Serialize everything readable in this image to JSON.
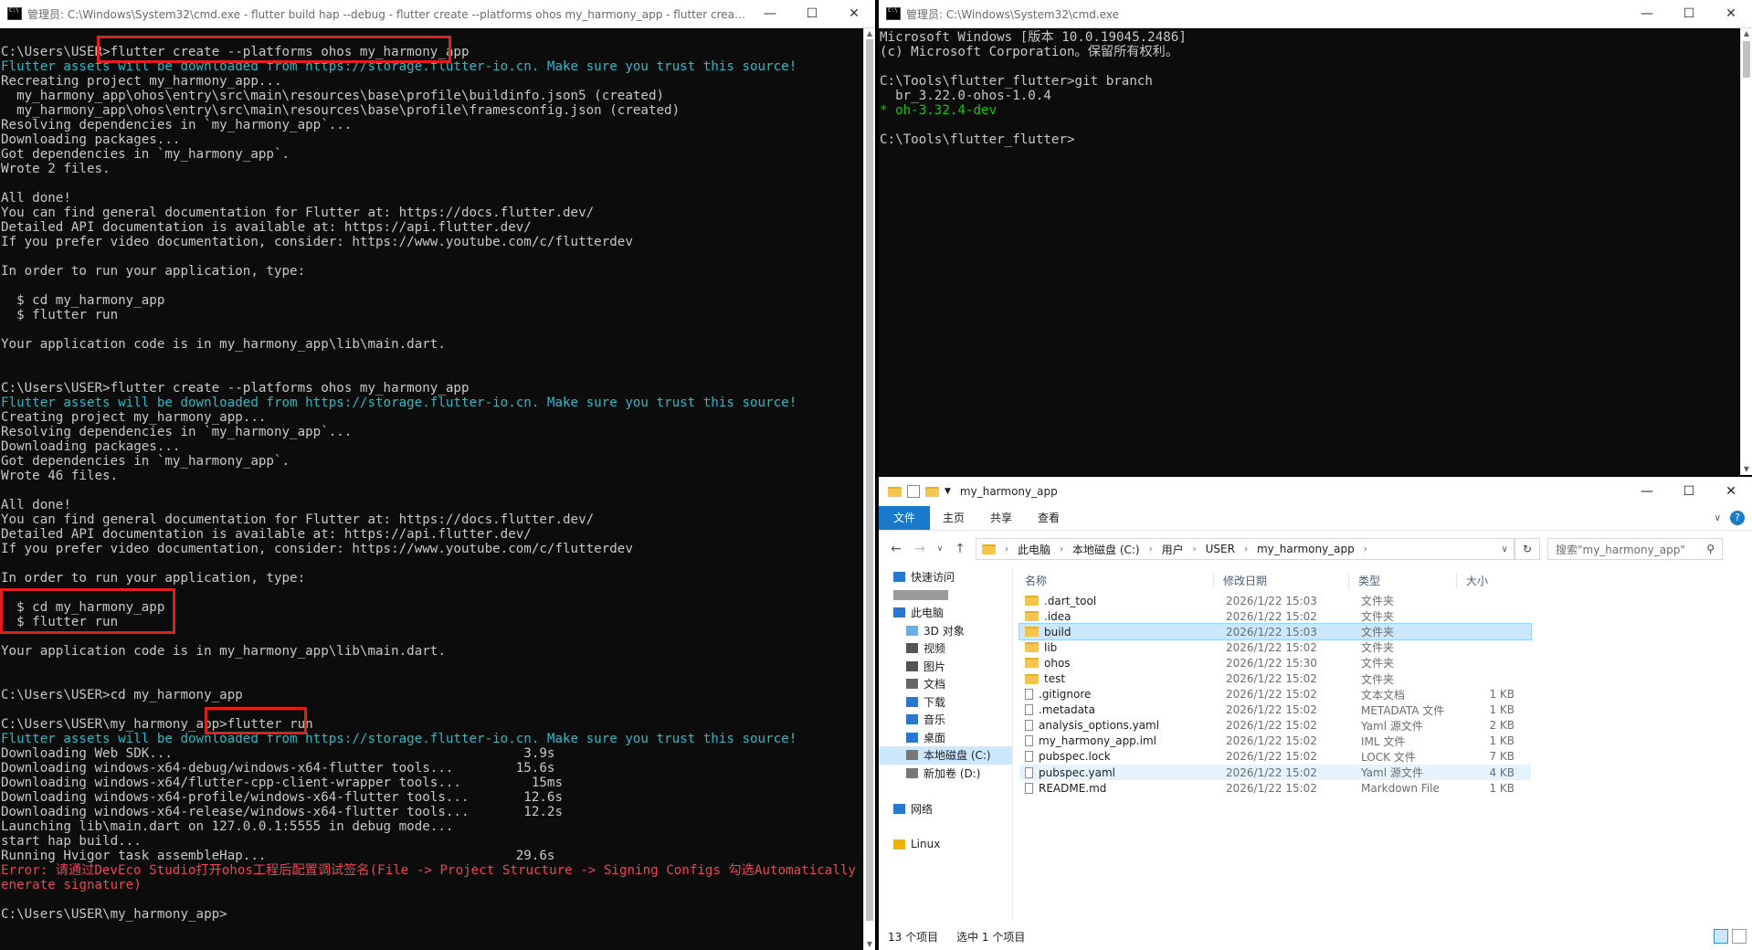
{
  "left_console": {
    "title": "管理员: C:\\Windows\\System32\\cmd.exe - flutter  build hap --debug - flutter  create --platforms ohos my_harmony_app - flutter  create ...",
    "lines": [
      {
        "t": "",
        "c": ""
      },
      {
        "t": "C:\\Users\\USER>flutter create --platforms ohos my_harmony_app",
        "c": ""
      },
      {
        "t": "Flutter assets will be downloaded from https://storage.flutter-io.cn. Make sure you trust this source!",
        "c": "teal"
      },
      {
        "t": "Recreating project my_harmony_app...",
        "c": ""
      },
      {
        "t": "  my_harmony_app\\ohos\\entry\\src\\main\\resources\\base\\profile\\buildinfo.json5 (created)",
        "c": ""
      },
      {
        "t": "  my_harmony_app\\ohos\\entry\\src\\main\\resources\\base\\profile\\framesconfig.json (created)",
        "c": ""
      },
      {
        "t": "Resolving dependencies in `my_harmony_app`...",
        "c": ""
      },
      {
        "t": "Downloading packages...",
        "c": ""
      },
      {
        "t": "Got dependencies in `my_harmony_app`.",
        "c": ""
      },
      {
        "t": "Wrote 2 files.",
        "c": ""
      },
      {
        "t": "",
        "c": ""
      },
      {
        "t": "All done!",
        "c": ""
      },
      {
        "t": "You can find general documentation for Flutter at: https://docs.flutter.dev/",
        "c": ""
      },
      {
        "t": "Detailed API documentation is available at: https://api.flutter.dev/",
        "c": ""
      },
      {
        "t": "If you prefer video documentation, consider: https://www.youtube.com/c/flutterdev",
        "c": ""
      },
      {
        "t": "",
        "c": ""
      },
      {
        "t": "In order to run your application, type:",
        "c": ""
      },
      {
        "t": "",
        "c": ""
      },
      {
        "t": "  $ cd my_harmony_app",
        "c": ""
      },
      {
        "t": "  $ flutter run",
        "c": ""
      },
      {
        "t": "",
        "c": ""
      },
      {
        "t": "Your application code is in my_harmony_app\\lib\\main.dart.",
        "c": ""
      },
      {
        "t": "",
        "c": ""
      },
      {
        "t": "",
        "c": ""
      },
      {
        "t": "C:\\Users\\USER>flutter create --platforms ohos my_harmony_app",
        "c": ""
      },
      {
        "t": "Flutter assets will be downloaded from https://storage.flutter-io.cn. Make sure you trust this source!",
        "c": "teal"
      },
      {
        "t": "Creating project my_harmony_app...",
        "c": ""
      },
      {
        "t": "Resolving dependencies in `my_harmony_app`...",
        "c": ""
      },
      {
        "t": "Downloading packages...",
        "c": ""
      },
      {
        "t": "Got dependencies in `my_harmony_app`.",
        "c": ""
      },
      {
        "t": "Wrote 46 files.",
        "c": ""
      },
      {
        "t": "",
        "c": ""
      },
      {
        "t": "All done!",
        "c": ""
      },
      {
        "t": "You can find general documentation for Flutter at: https://docs.flutter.dev/",
        "c": ""
      },
      {
        "t": "Detailed API documentation is available at: https://api.flutter.dev/",
        "c": ""
      },
      {
        "t": "If you prefer video documentation, consider: https://www.youtube.com/c/flutterdev",
        "c": ""
      },
      {
        "t": "",
        "c": ""
      },
      {
        "t": "In order to run your application, type:",
        "c": ""
      },
      {
        "t": "",
        "c": ""
      },
      {
        "t": "  $ cd my_harmony_app",
        "c": ""
      },
      {
        "t": "  $ flutter run",
        "c": ""
      },
      {
        "t": "",
        "c": ""
      },
      {
        "t": "Your application code is in my_harmony_app\\lib\\main.dart.",
        "c": ""
      },
      {
        "t": "",
        "c": ""
      },
      {
        "t": "",
        "c": ""
      },
      {
        "t": "C:\\Users\\USER>cd my_harmony_app",
        "c": ""
      },
      {
        "t": "",
        "c": ""
      },
      {
        "t": "C:\\Users\\USER\\my_harmony_app>flutter run",
        "c": ""
      },
      {
        "t": "Flutter assets will be downloaded from https://storage.flutter-io.cn. Make sure you trust this source!",
        "c": "teal"
      },
      {
        "t": "Downloading Web SDK...                                             3.9s",
        "c": ""
      },
      {
        "t": "Downloading windows-x64-debug/windows-x64-flutter tools...        15.6s",
        "c": ""
      },
      {
        "t": "Downloading windows-x64/flutter-cpp-client-wrapper tools...         15ms",
        "c": ""
      },
      {
        "t": "Downloading windows-x64-profile/windows-x64-flutter tools...       12.6s",
        "c": ""
      },
      {
        "t": "Downloading windows-x64-release/windows-x64-flutter tools...       12.2s",
        "c": ""
      },
      {
        "t": "Launching lib\\main.dart on 127.0.0.1:5555 in debug mode...",
        "c": ""
      },
      {
        "t": "start hap build...",
        "c": ""
      },
      {
        "t": "Running Hvigor task assembleHap...                                29.6s",
        "c": ""
      },
      {
        "t": "Error: 请通过DevEco Studio打开ohos工程后配置调试签名(File -> Project Structure -> Signing Configs 勾选Automatically g",
        "c": "red"
      },
      {
        "t": "enerate signature)",
        "c": "red"
      },
      {
        "t": "",
        "c": ""
      },
      {
        "t": "C:\\Users\\USER\\my_harmony_app>",
        "c": ""
      }
    ]
  },
  "right_console": {
    "title": "管理员: C:\\Windows\\System32\\cmd.exe",
    "lines": [
      {
        "t": "Microsoft Windows [版本 10.0.19045.2486]",
        "c": ""
      },
      {
        "t": "(c) Microsoft Corporation。保留所有权利。",
        "c": ""
      },
      {
        "t": "",
        "c": ""
      },
      {
        "t": "C:\\Tools\\flutter_flutter>git branch",
        "c": ""
      },
      {
        "t": "  br_3.22.0-ohos-1.0.4",
        "c": ""
      },
      {
        "t": "* oh-3.32.4-dev",
        "c": "green"
      },
      {
        "t": "",
        "c": ""
      },
      {
        "t": "C:\\Tools\\flutter_flutter>",
        "c": ""
      }
    ]
  },
  "window_controls": {
    "minimize": "—",
    "maximize": "☐",
    "close": "✕"
  },
  "explorer": {
    "title": "my_harmony_app",
    "ribbon": [
      "文件",
      "主页",
      "共享",
      "查看"
    ],
    "path": [
      "此电脑",
      "本地磁盘 (C:)",
      "用户",
      "USER",
      "my_harmony_app"
    ],
    "search_placeholder": "搜索\"my_harmony_app\"",
    "nav": [
      {
        "label": "快速访问",
        "icon": "star-icon",
        "indent": 1
      },
      {
        "label": "",
        "icon": "blurred-icon",
        "indent": 1
      },
      {
        "label": "此电脑",
        "icon": "pc-icon",
        "indent": 1
      },
      {
        "label": "3D 对象",
        "icon": "cube-icon",
        "indent": 2
      },
      {
        "label": "视频",
        "icon": "video-icon",
        "indent": 2
      },
      {
        "label": "图片",
        "icon": "image-icon",
        "indent": 2
      },
      {
        "label": "文档",
        "icon": "document-icon",
        "indent": 2
      },
      {
        "label": "下载",
        "icon": "download-icon",
        "indent": 2
      },
      {
        "label": "音乐",
        "icon": "music-icon",
        "indent": 2
      },
      {
        "label": "桌面",
        "icon": "desktop-icon",
        "indent": 2
      },
      {
        "label": "本地磁盘 (C:)",
        "icon": "drive-icon",
        "indent": 2,
        "selected": true
      },
      {
        "label": "新加卷 (D:)",
        "icon": "drive-icon",
        "indent": 2
      },
      {
        "label": "",
        "icon": "",
        "indent": 1
      },
      {
        "label": "网络",
        "icon": "network-icon",
        "indent": 1
      },
      {
        "label": "",
        "icon": "",
        "indent": 1
      },
      {
        "label": "Linux",
        "icon": "linux-icon",
        "indent": 1
      }
    ],
    "columns": {
      "name": "名称",
      "date": "修改日期",
      "type": "类型",
      "size": "大小"
    },
    "files": [
      {
        "name": ".dart_tool",
        "date": "2026/1/22 15:03",
        "type": "文件夹",
        "size": "",
        "folder": true
      },
      {
        "name": ".idea",
        "date": "2026/1/22 15:02",
        "type": "文件夹",
        "size": "",
        "folder": true
      },
      {
        "name": "build",
        "date": "2026/1/22 15:03",
        "type": "文件夹",
        "size": "",
        "folder": true,
        "selected": true
      },
      {
        "name": "lib",
        "date": "2026/1/22 15:02",
        "type": "文件夹",
        "size": "",
        "folder": true
      },
      {
        "name": "ohos",
        "date": "2026/1/22 15:30",
        "type": "文件夹",
        "size": "",
        "folder": true
      },
      {
        "name": "test",
        "date": "2026/1/22 15:02",
        "type": "文件夹",
        "size": "",
        "folder": true
      },
      {
        "name": ".gitignore",
        "date": "2026/1/22 15:02",
        "type": "文本文档",
        "size": "1 KB"
      },
      {
        "name": ".metadata",
        "date": "2026/1/22 15:02",
        "type": "METADATA 文件",
        "size": "1 KB"
      },
      {
        "name": "analysis_options.yaml",
        "date": "2026/1/22 15:02",
        "type": "Yaml 源文件",
        "size": "2 KB"
      },
      {
        "name": "my_harmony_app.iml",
        "date": "2026/1/22 15:02",
        "type": "IML 文件",
        "size": "1 KB"
      },
      {
        "name": "pubspec.lock",
        "date": "2026/1/22 15:02",
        "type": "LOCK 文件",
        "size": "7 KB"
      },
      {
        "name": "pubspec.yaml",
        "date": "2026/1/22 15:02",
        "type": "Yaml 源文件",
        "size": "4 KB",
        "hover": true
      },
      {
        "name": "README.md",
        "date": "2026/1/22 15:02",
        "type": "Markdown File",
        "size": "1 KB"
      }
    ],
    "status_count": "13 个项目",
    "status_selected": "选中 1 个项目"
  },
  "colors": {
    "highlight_box": "#e02020",
    "console_bg": "#0c0c0c",
    "accent": "#1979ca"
  }
}
